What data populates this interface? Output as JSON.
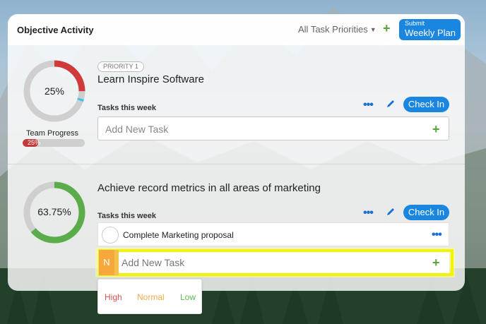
{
  "header": {
    "title": "Objective Activity",
    "filter_label": "All Task Priorities",
    "submit_small": "Submit",
    "submit_big": "Weekly Plan"
  },
  "objectives": [
    {
      "progress_text": "25%",
      "progress": 0.25,
      "accent": "#d03a3a",
      "priority_badge": "PRIORITY 1",
      "name": "Learn Inspire Software",
      "tasks_label": "Tasks this week",
      "checkin_label": "Check In",
      "add_task_placeholder": "Add New Task",
      "team_label": "Team Progress",
      "team_progress_text": "25%",
      "team_progress": 0.25
    },
    {
      "progress_text": "63.75%",
      "progress": 0.6375,
      "accent": "#5aad4a",
      "name": "Achieve record metrics in all areas of marketing",
      "tasks_label": "Tasks this week",
      "checkin_label": "Check In",
      "task_name": "Complete Marketing proposal",
      "priority_letter": "N",
      "add_task_placeholder": "Add New Task"
    }
  ],
  "priority_options": [
    {
      "label": "High",
      "color": "#d9534f"
    },
    {
      "label": "Normal",
      "color": "#f0ad4e"
    },
    {
      "label": "Low",
      "color": "#5cb85c"
    }
  ],
  "colors": {
    "primary_blue": "#1a86e0",
    "add_green": "#5aa43c",
    "highlight_yellow": "#f4f400"
  }
}
